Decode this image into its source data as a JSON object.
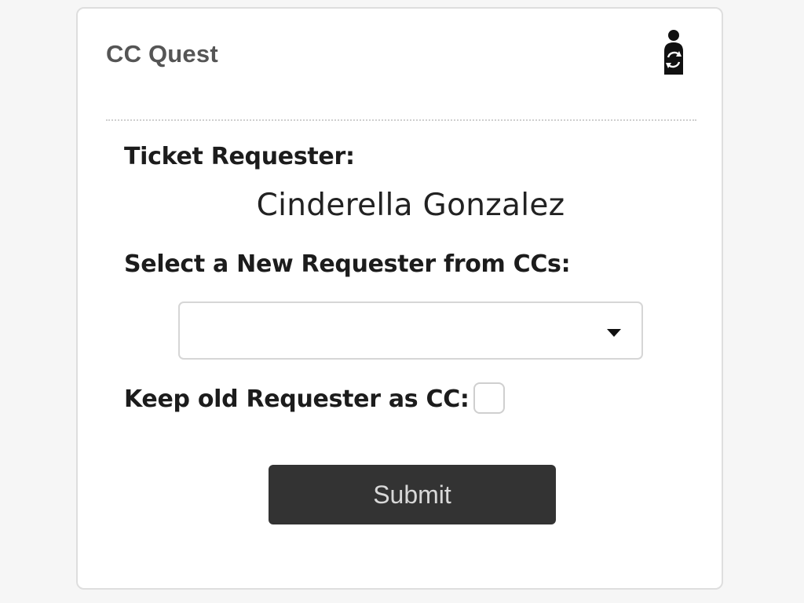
{
  "app": {
    "title": "CC Quest",
    "icon": "person-swap-icon"
  },
  "form": {
    "requester_label": "Ticket Requester:",
    "requester_name": "Cinderella Gonzalez",
    "select_label": "Select a New Requester from CCs:",
    "select_value": "",
    "keep_label": "Keep old Requester as CC:",
    "keep_checked": false,
    "submit_label": "Submit"
  },
  "colors": {
    "button_bg": "#333333",
    "button_text": "#d8d8d8",
    "title": "#555555"
  }
}
